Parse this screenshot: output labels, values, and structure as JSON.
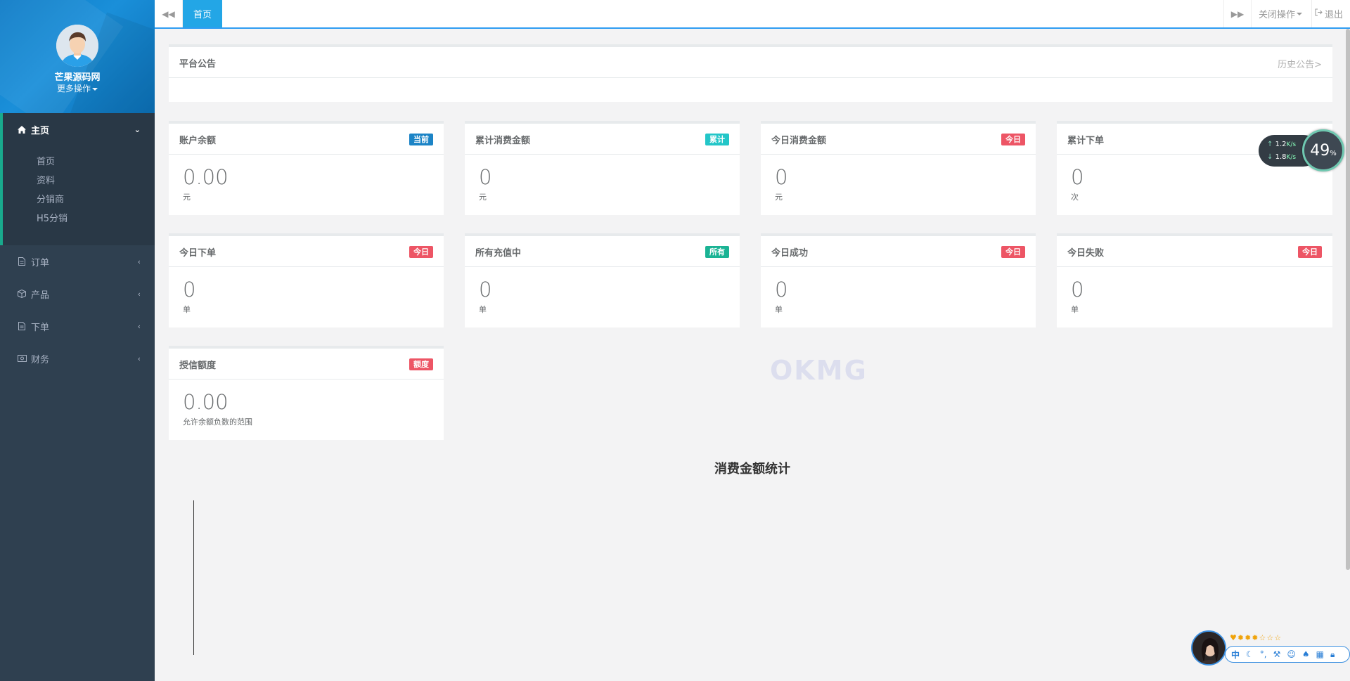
{
  "sidebar": {
    "profile": {
      "name": "芒果源码网",
      "more": "更多操作"
    },
    "main_group": {
      "label": "主页",
      "items": [
        "首页",
        "资料",
        "分销商",
        "H5分销"
      ]
    },
    "groups": [
      {
        "label": "订单",
        "icon": "file-icon"
      },
      {
        "label": "产品",
        "icon": "cube-icon"
      },
      {
        "label": "下单",
        "icon": "file-icon"
      },
      {
        "label": "财务",
        "icon": "money-icon"
      }
    ]
  },
  "topbar": {
    "active_tab": "首页",
    "close_ops": "关闭操作",
    "logout": "退出"
  },
  "notice": {
    "title": "平台公告",
    "history_link": "历史公告>"
  },
  "stats": [
    {
      "title": "账户余额",
      "badge": "当前",
      "badge_color": "#1c84c6",
      "value": "0.00",
      "unit": "元"
    },
    {
      "title": "累计消费金额",
      "badge": "累计",
      "badge_color": "#23c6c8",
      "value": "0",
      "unit": "元"
    },
    {
      "title": "今日消费金额",
      "badge": "今日",
      "badge_color": "#ed5565",
      "value": "0",
      "unit": "元"
    },
    {
      "title": "累计下单",
      "badge": "",
      "badge_color": "#1ab394",
      "value": "0",
      "unit": "次"
    },
    {
      "title": "今日下单",
      "badge": "今日",
      "badge_color": "#ed5565",
      "value": "0",
      "unit": "单"
    },
    {
      "title": "所有充值中",
      "badge": "所有",
      "badge_color": "#1ab394",
      "value": "0",
      "unit": "单"
    },
    {
      "title": "今日成功",
      "badge": "今日",
      "badge_color": "#ed5565",
      "value": "0",
      "unit": "单"
    },
    {
      "title": "今日失败",
      "badge": "今日",
      "badge_color": "#ed5565",
      "value": "0",
      "unit": "单"
    },
    {
      "title": "授信额度",
      "badge": "额度",
      "badge_color": "#ed5565",
      "value": "0.00",
      "unit": "允许余额负数的范围"
    }
  ],
  "chart": {
    "title": "消费金额统计"
  },
  "watermark": "OKMG",
  "speed_widget": {
    "up": "1.2",
    "down": "1.8",
    "unit": "K/s",
    "percent": "49",
    "percent_sign": "%"
  },
  "ime": {
    "chinese": "中"
  }
}
